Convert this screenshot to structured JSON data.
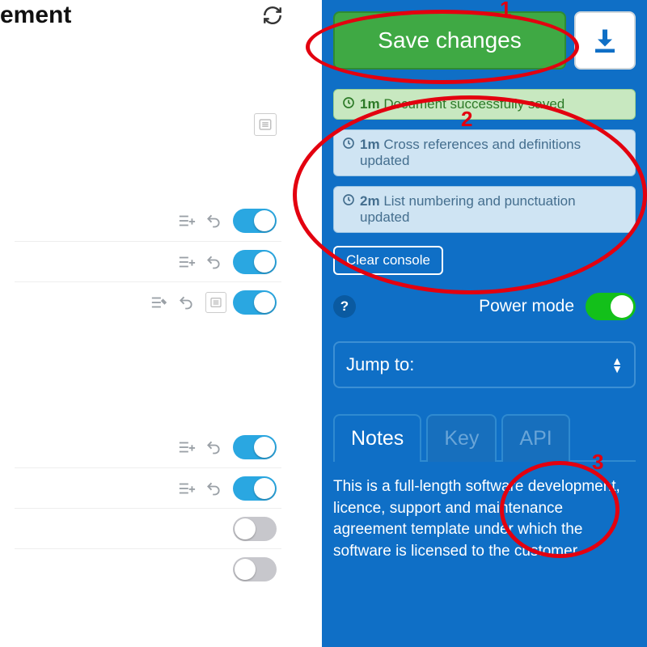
{
  "header": {
    "title_fragment": "ement"
  },
  "sidebar": {
    "save_label": "Save changes",
    "notices": [
      {
        "time": "1m",
        "text": "Document successfully saved",
        "variant": "green"
      },
      {
        "time": "1m",
        "text": "Cross references and definitions updated",
        "variant": "blue"
      },
      {
        "time": "2m",
        "text": "List numbering and punctuation updated",
        "variant": "blue"
      }
    ],
    "clear_label": "Clear console",
    "power_label": "Power mode",
    "jump_label": "Jump to:",
    "tabs": {
      "notes": "Notes",
      "key": "Key",
      "api": "API",
      "active": "notes"
    },
    "notes_body": "This is a full-length software development, licence, support and maintenance agreement template under which the software is licensed to the customer"
  },
  "annotations": {
    "one": "1",
    "two": "2",
    "three": "3"
  },
  "colors": {
    "panel_blue": "#0f6fc6",
    "save_green": "#3fa944",
    "toggle_blue": "#2aa7e1",
    "toggle_green": "#13c01a",
    "annotation_red": "#e3000f"
  }
}
